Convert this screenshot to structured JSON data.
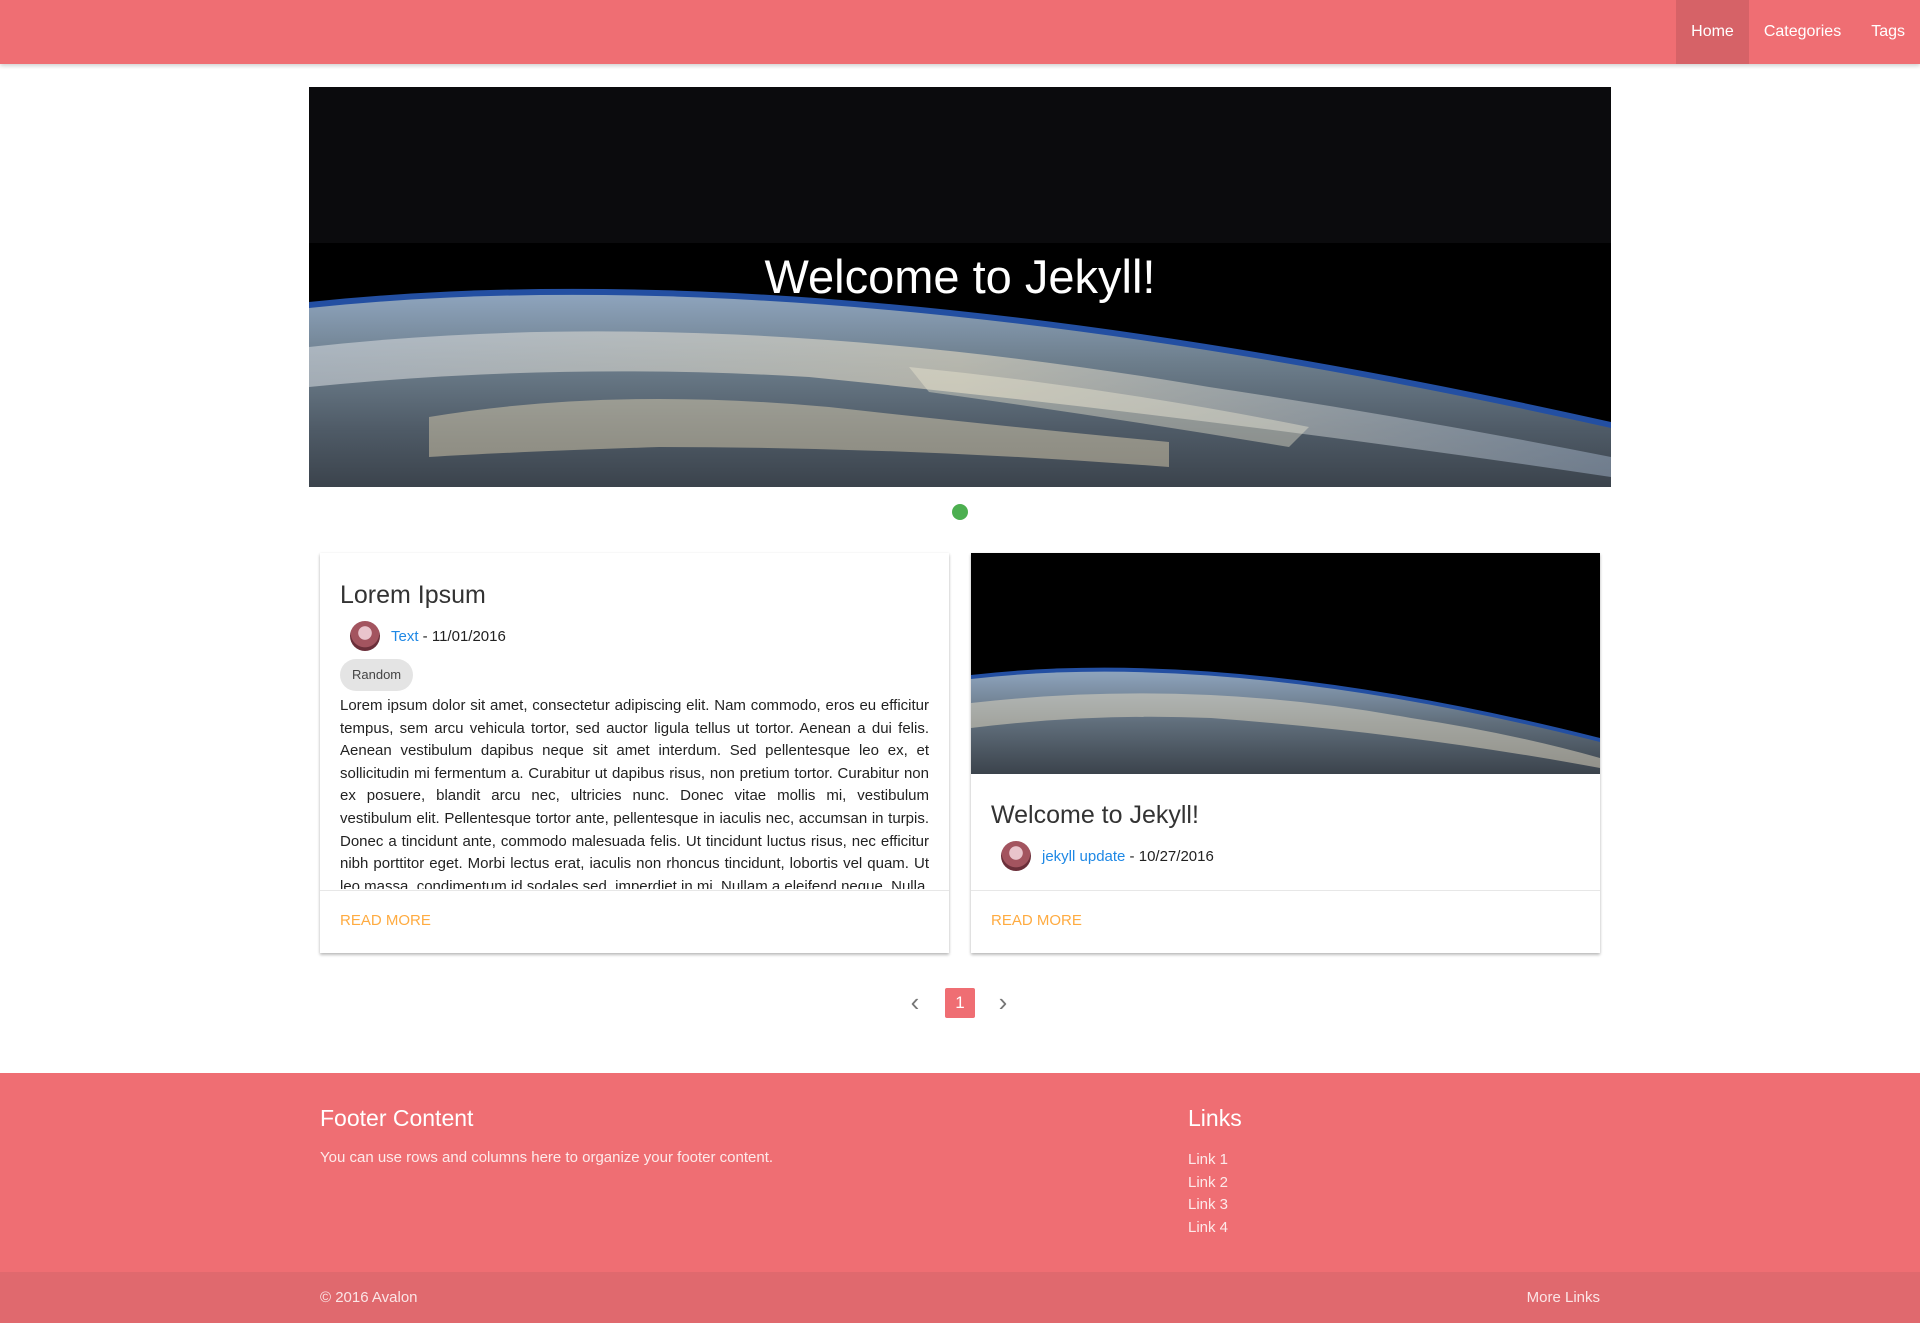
{
  "nav": {
    "items": [
      {
        "label": "Home",
        "active": true
      },
      {
        "label": "Categories",
        "active": false
      },
      {
        "label": "Tags",
        "active": false
      }
    ],
    "color": "#ef6e73"
  },
  "hero": {
    "title": "Welcome to Jekyll!",
    "slide_count": 1,
    "active_indicator_color": "#4caf50"
  },
  "posts": [
    {
      "title": "Lorem Ipsum",
      "category": "Text",
      "date": "11/01/2016",
      "tag": "Random",
      "excerpt": "Lorem ipsum dolor sit amet, consectetur adipiscing elit. Nam commodo, eros eu efficitur tempus, sem arcu vehicula tortor, sed auctor ligula tellus ut tortor. Aenean a dui felis. Aenean vestibulum dapibus neque sit amet interdum. Sed pellentesque leo ex, et sollicitudin mi fermentum a. Curabitur ut dapibus risus, non pretium tortor. Curabitur non ex posuere, blandit arcu nec, ultricies nunc. Donec vitae mollis mi, vestibulum vestibulum elit. Pellentesque tortor ante, pellentesque in iaculis nec, accumsan in turpis. Donec a tincidunt ante, commodo malesuada felis. Ut tincidunt luctus risus, nec efficitur nibh porttitor eget. Morbi lectus erat, iaculis non rhoncus tincidunt, lobortis vel quam. Ut leo massa, condimentum id sodales sed, imperdiet in mi. Nullam a eleifend neque. Nulla",
      "action": "Read more"
    },
    {
      "title": "Welcome to Jekyll!",
      "category": "jekyll update",
      "date": "10/27/2016",
      "action": "Read more"
    }
  ],
  "pagination": {
    "prev_icon": "chevron-left-icon",
    "current": "1",
    "next_icon": "chevron-right-icon"
  },
  "footer": {
    "heading": "Footer Content",
    "text": "You can use rows and columns here to organize your footer content.",
    "links_heading": "Links",
    "links": [
      "Link 1",
      "Link 2",
      "Link 3",
      "Link 4"
    ],
    "copyright": "© 2016 Avalon",
    "more_links": "More Links"
  }
}
